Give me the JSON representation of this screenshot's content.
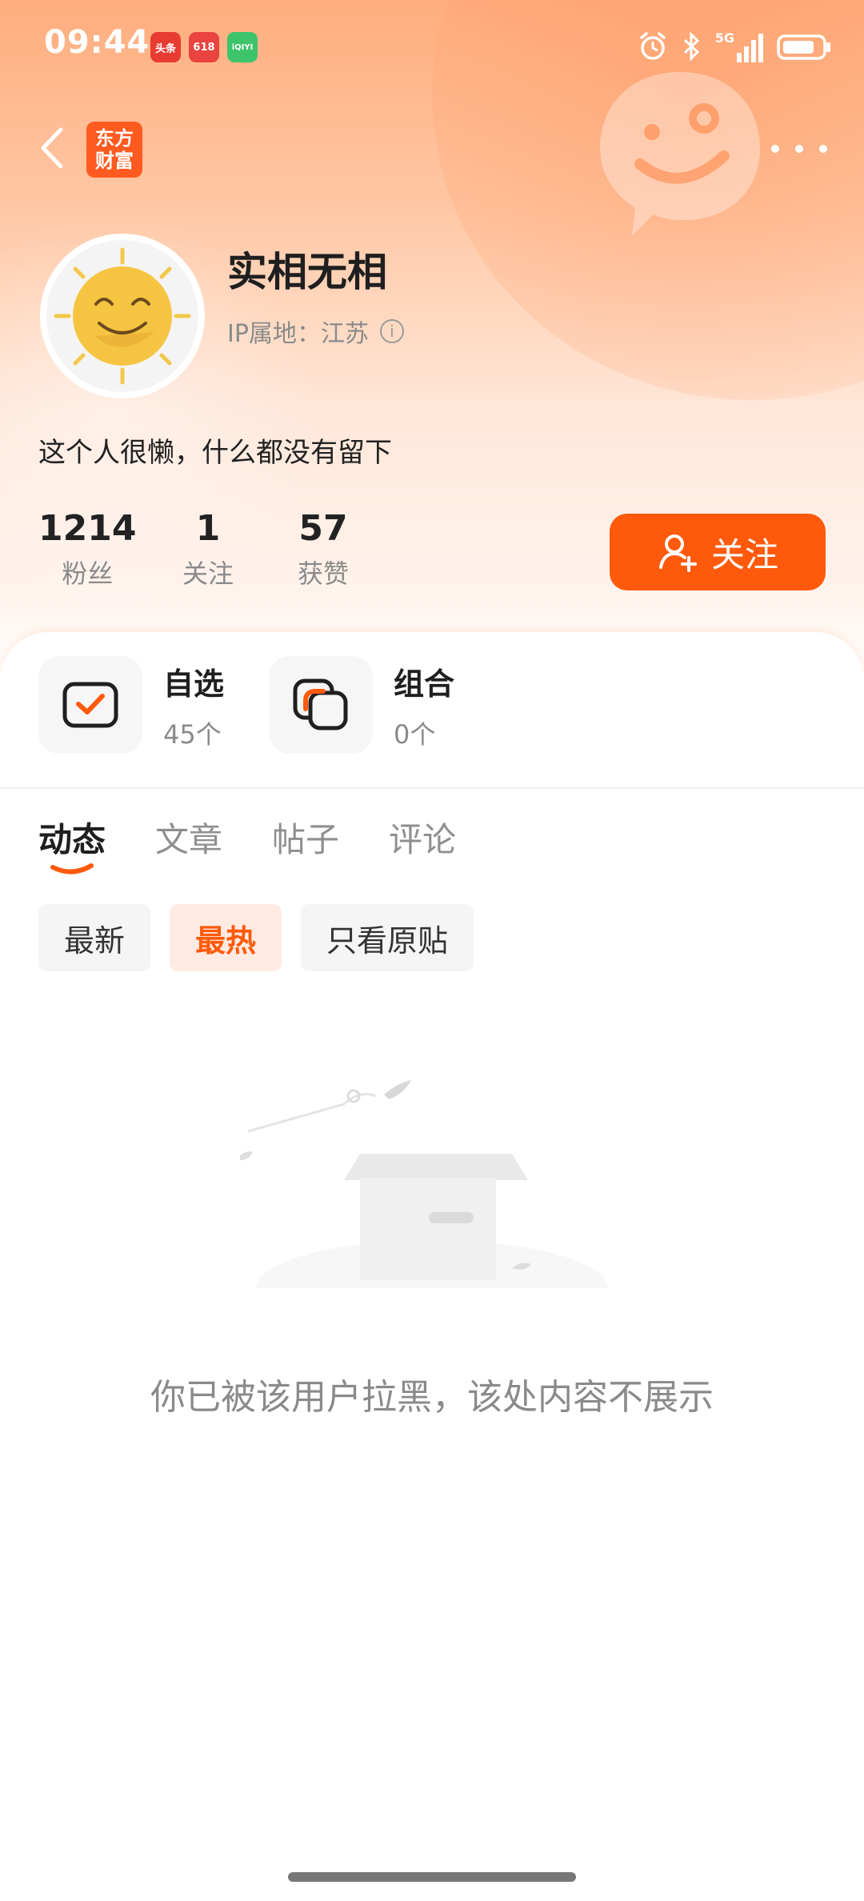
{
  "status_bar": {
    "time": "09:44",
    "apps": [
      {
        "icon": "toutiao-app-icon",
        "label": "头条",
        "color": "#e83b32"
      },
      {
        "icon": "618-app-icon",
        "label": "618",
        "color": "#e9443f"
      },
      {
        "icon": "iqiyi-app-icon",
        "label": "iQIYI",
        "color": "#3dc46a"
      }
    ],
    "network": "5G"
  },
  "header": {
    "logo_line1": "东方",
    "logo_line2": "财富"
  },
  "profile": {
    "username": "实相无相",
    "ip_location": "IP属地：江苏",
    "bio": "这个人很懒，什么都没有留下",
    "stats": [
      {
        "value": "1214",
        "label": "粉丝"
      },
      {
        "value": "1",
        "label": "关注"
      },
      {
        "value": "57",
        "label": "获赞"
      }
    ],
    "follow_label": "关注"
  },
  "shortcuts": [
    {
      "title": "自选",
      "sub": "45个"
    },
    {
      "title": "组合",
      "sub": "0个"
    }
  ],
  "tabs": [
    "动态",
    "文章",
    "帖子",
    "评论"
  ],
  "active_tab": "动态",
  "filters": [
    "最新",
    "最热",
    "只看原贴"
  ],
  "active_filter": "最热",
  "empty_message": "你已被该用户拉黑，该处内容不展示",
  "colors": {
    "accent": "#ff5a0c",
    "hero_top": "#ffad7e",
    "text_primary": "#1f1f1f",
    "text_secondary": "#8a8a8a"
  }
}
